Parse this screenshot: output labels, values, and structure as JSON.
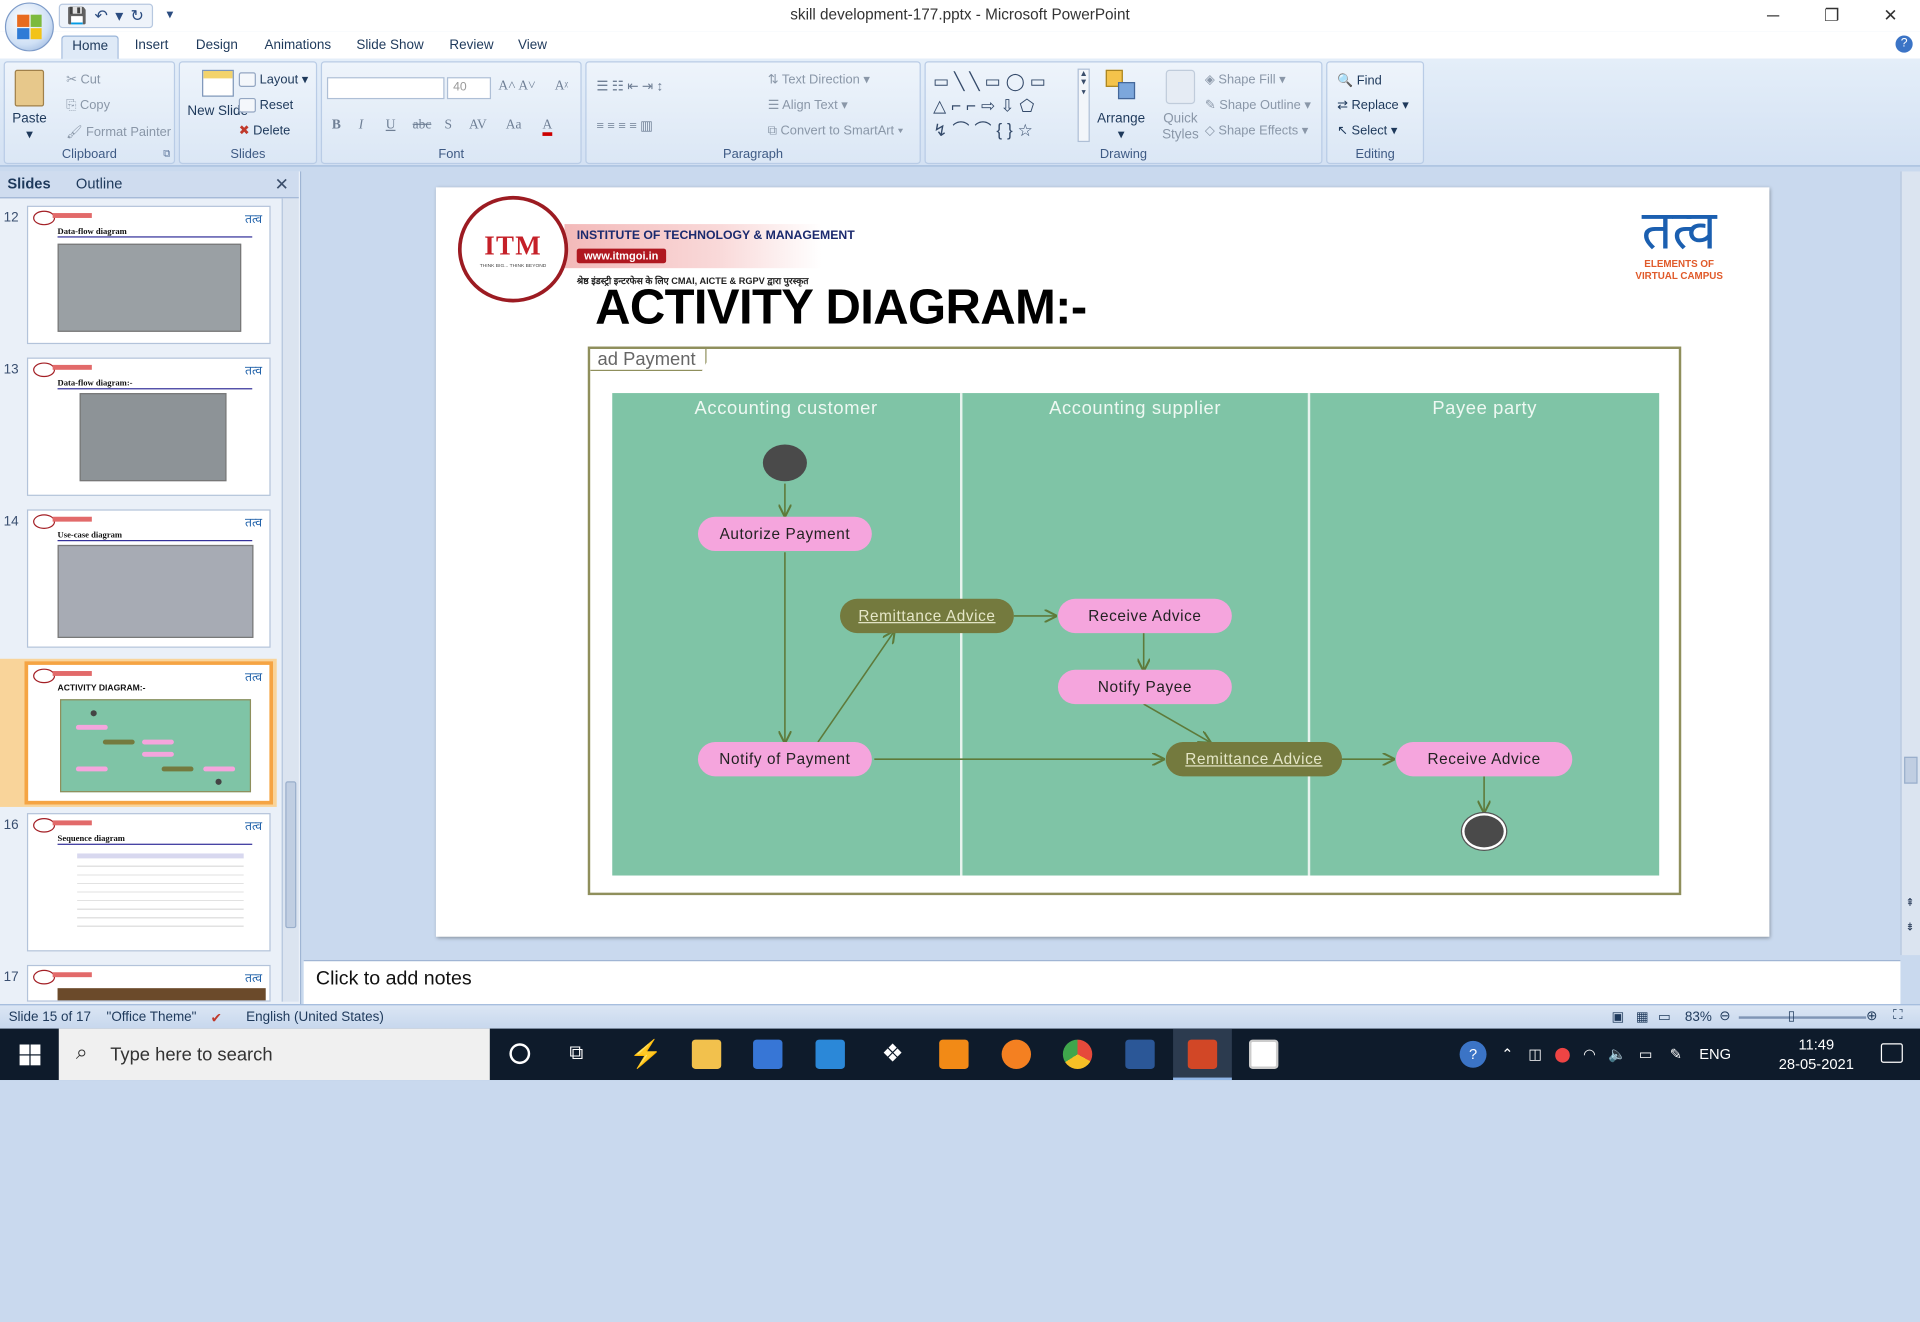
{
  "window": {
    "title": "skill development-177.pptx - Microsoft PowerPoint",
    "min": "─",
    "max": "❐",
    "close": "✕"
  },
  "ribbon_tabs": [
    "Home",
    "Insert",
    "Design",
    "Animations",
    "Slide Show",
    "Review",
    "View"
  ],
  "ribbon": {
    "clipboard": {
      "label": "Clipboard",
      "paste": "Paste",
      "cut": "Cut",
      "copy": "Copy",
      "format_painter": "Format Painter"
    },
    "slides": {
      "label": "Slides",
      "new_slide": "New Slide",
      "layout": "Layout",
      "reset": "Reset",
      "delete": "Delete"
    },
    "font": {
      "label": "Font",
      "size": "40"
    },
    "paragraph": {
      "label": "Paragraph",
      "text_direction": "Text Direction",
      "align_text": "Align Text",
      "convert": "Convert to SmartArt"
    },
    "drawing": {
      "label": "Drawing",
      "arrange": "Arrange",
      "quick_styles": "Quick Styles",
      "shape_fill": "Shape Fill",
      "shape_outline": "Shape Outline",
      "shape_effects": "Shape Effects"
    },
    "editing": {
      "label": "Editing",
      "find": "Find",
      "replace": "Replace",
      "select": "Select"
    }
  },
  "left_pane": {
    "tab_slides": "Slides",
    "tab_outline": "Outline",
    "thumbnails": [
      {
        "num": "12",
        "title": "Data-flow diagram"
      },
      {
        "num": "13",
        "title": "Data-flow diagram:-"
      },
      {
        "num": "14",
        "title": "Use-case diagram"
      },
      {
        "num": "15",
        "title": "ACTIVITY DIAGRAM:-"
      },
      {
        "num": "16",
        "title": "Sequence diagram"
      },
      {
        "num": "17",
        "title": ""
      }
    ]
  },
  "slide": {
    "logo_itm": "ITM",
    "institute_name": "INSTITUTE OF TECHNOLOGY & MANAGEMENT",
    "website": "www.itmgoi.in",
    "hindi_tagline": "श्रेष्ठ इंडस्ट्री इन्टरफेस के लिए CMAI, AICTE & RGPV द्वारा पुरस्कृत",
    "tatva_glyph": "तत्व",
    "tatva_sub1": "ELEMENTS OF",
    "tatva_sub2": "VIRTUAL CAMPUS",
    "title": "ACTIVITY DIAGRAM:-",
    "frame_label": "ad Payment",
    "lanes": [
      "Accounting customer",
      "Accounting supplier",
      "Payee party"
    ],
    "nodes": {
      "authorize": "Autorize Payment",
      "remittance1": "Remittance Advice",
      "receive1": "Receive Advice",
      "notify_payee": "Notify Payee",
      "notify_payment": "Notify of Payment",
      "remittance2": "Remittance Advice",
      "receive2": "Receive Advice"
    }
  },
  "notes_placeholder": "Click to add notes",
  "status": {
    "slide": "Slide 15 of 17",
    "theme": "\"Office Theme\"",
    "language": "English (United States)",
    "zoom": "83%"
  },
  "taskbar": {
    "search_placeholder": "Type here to search",
    "lang": "ENG",
    "time": "11:49",
    "date": "28-05-2021"
  },
  "colors": {
    "lane_bg": "#7fc4a6",
    "pink_node": "#f5a5dd",
    "olive_node": "#747a3e",
    "selected_thumb": "#f5a443"
  }
}
